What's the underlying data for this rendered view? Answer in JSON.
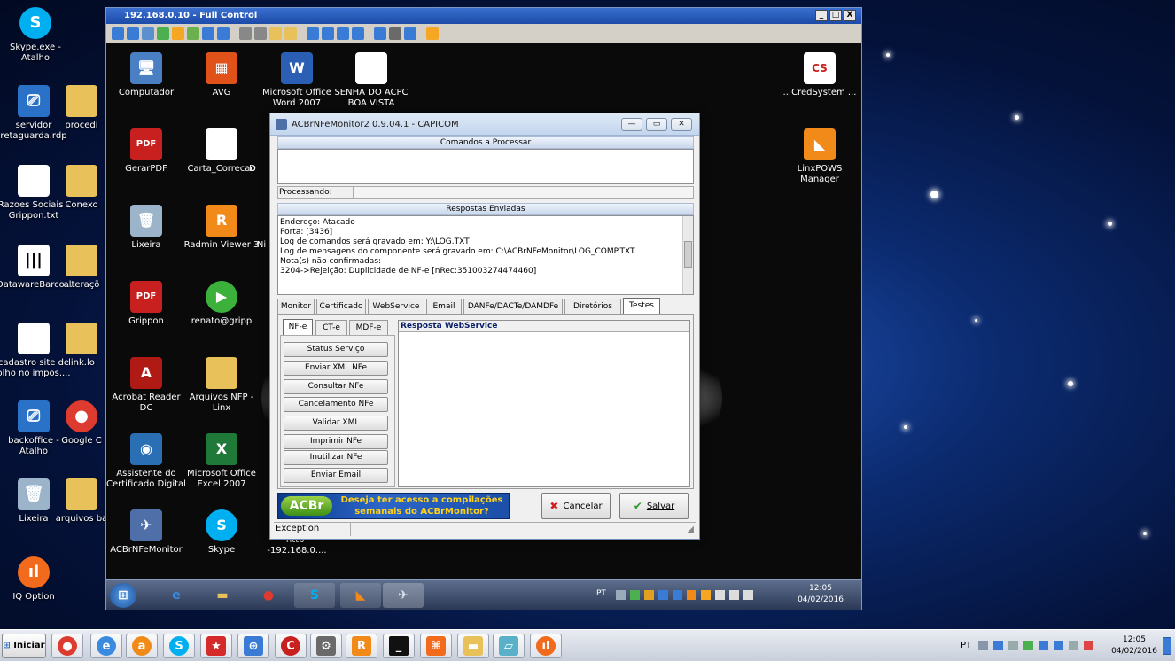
{
  "desktop_icons": [
    {
      "label": "Skype.exe - Atalho",
      "color": "#00aff0",
      "glyph": "S"
    },
    {
      "label": "servidor retaguarda.rdp",
      "color": "#2a72c8",
      "glyph": "⎚"
    },
    {
      "label": "procedi",
      "color": "#e8c15a",
      "glyph": ""
    },
    {
      "label": "Razoes Sociais - Grippon.txt",
      "color": "#ffffff",
      "glyph": ""
    },
    {
      "label": "Conexo",
      "color": "#e8c15a",
      "glyph": ""
    },
    {
      "label": "DatawareBarco....",
      "color": "#ffffff",
      "glyph": "|||"
    },
    {
      "label": "alteraçõ",
      "color": "#e8c15a",
      "glyph": ""
    },
    {
      "label": "cadastro site de olho no impos....",
      "color": "#ffffff",
      "glyph": ""
    },
    {
      "label": "link.lo",
      "color": "#e8c15a",
      "glyph": ""
    },
    {
      "label": "backoffice - Atalho",
      "color": "#2a72c8",
      "glyph": "⎚"
    },
    {
      "label": "Google C",
      "color": "#de3b30",
      "glyph": "●"
    },
    {
      "label": "Lixeira",
      "color": "#9bb4c9",
      "glyph": "🗑"
    },
    {
      "label": "arquivos ba",
      "color": "#e8c15a",
      "glyph": ""
    },
    {
      "label": "IQ Option",
      "color": "#f26a1b",
      "glyph": "ıl"
    }
  ],
  "remote_window": {
    "title": "192.168.0.10 - Full Control",
    "min": "_",
    "max": "□",
    "close": "X"
  },
  "remote_icons": [
    {
      "label": "Computador",
      "color": "#4a7fc3",
      "glyph": "🖥"
    },
    {
      "label": "AVG",
      "color": "#e0521a",
      "glyph": "▦"
    },
    {
      "label": "Microsoft Office Word 2007",
      "color": "#2b5fb4",
      "glyph": "W"
    },
    {
      "label": "SENHA DO ACPC BOA VISTA",
      "color": "#ffffff",
      "glyph": ""
    },
    {
      "label": "GerarPDF",
      "color": "#c8201e",
      "glyph": "PDF"
    },
    {
      "label": "Carta_Correcao",
      "color": "#ffffff",
      "glyph": ""
    },
    {
      "label": "D",
      "color": "#e8c15a",
      "glyph": ""
    },
    {
      "label": "Lixeira",
      "color": "#9bb4c9",
      "glyph": "🗑"
    },
    {
      "label": "Radmin Viewer 3",
      "color": "#f28a1a",
      "glyph": "R"
    },
    {
      "label": "Ni",
      "color": "#e8c15a",
      "glyph": ""
    },
    {
      "label": "Grippon",
      "color": "#c8201e",
      "glyph": "PDF"
    },
    {
      "label": "renato@gripp",
      "color": "#3bb03b",
      "glyph": "▶"
    },
    {
      "label": "Acrobat Reader DC",
      "color": "#b01a14",
      "glyph": "A"
    },
    {
      "label": "Arquivos NFP - Linx",
      "color": "#e8c15a",
      "glyph": ""
    },
    {
      "label": "Assistente do Certificado Digital",
      "color": "#2a6fb4",
      "glyph": "◉"
    },
    {
      "label": "Microsoft Office Excel 2007",
      "color": "#1f7a3a",
      "glyph": "X"
    },
    {
      "label": "ACBrNFeMonitor",
      "color": "#4f6fa8",
      "glyph": "✈"
    },
    {
      "label": "Skype",
      "color": "#00aff0",
      "glyph": "S"
    },
    {
      "label": "http--192.168.0....",
      "color": "#2a72c8",
      "glyph": "e"
    },
    {
      "label": "...CredSystem ...",
      "color": "#ffffff",
      "glyph": "CS"
    },
    {
      "label": "LinxPOWS Manager",
      "color": "#f28a1a",
      "glyph": "◣"
    }
  ],
  "acbr": {
    "title": "ACBrNFeMonitor2 0.9.04.1 - CAPICOM",
    "commands_header": "Comandos a Processar",
    "processing_label": "Processando:",
    "responses_header": "Respostas Enviadas",
    "responses": [
      "Endereço: Atacado",
      "Porta: [3436]",
      "Log de comandos será gravado em: Y:\\LOG.TXT",
      "Log de mensagens do componente será gravado em: C:\\ACBrNFeMonitor\\LOG_COMP.TXT",
      "Nota(s) não confirmadas:",
      "3204->Rejeição: Duplicidade de NF-e [nRec:351003274474460]"
    ],
    "tabs": [
      "Monitor",
      "Certificado",
      "WebService",
      "Email",
      "DANFe/DACTe/DAMDFe",
      "Diretórios",
      "Testes"
    ],
    "subtabs": [
      "NF-e",
      "CT-e",
      "MDF-e"
    ],
    "ws_header": "Resposta WebService",
    "buttons": [
      "Status Serviço",
      "Enviar XML NFe",
      "Consultar NFe",
      "Cancelamento NFe",
      "Validar XML",
      "Imprimir NFe",
      "Inutilizar NFe",
      "Enviar Email"
    ],
    "banner_logo": "ACBr",
    "banner_text": "Deseja ter acesso a compilações semanais do ACBrMonitor?",
    "cancel_label": "Cancelar",
    "save_label": "Salvar",
    "status_text": "Exception"
  },
  "inner_taskbar": {
    "lang": "PT",
    "time": "12:05",
    "date": "04/02/2016"
  },
  "taskbar": {
    "start_label": "Iniciar",
    "lang": "PT",
    "time": "12:05",
    "date": "04/02/2016"
  }
}
